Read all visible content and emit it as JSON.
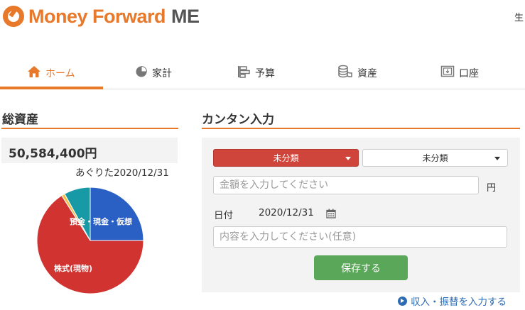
{
  "header": {
    "logo_text": "Money Forward",
    "logo_suffix": "ME",
    "user_link": "生",
    "brand_color": "#e8782a"
  },
  "nav": {
    "items": [
      {
        "label": "ホーム",
        "icon": "home-icon",
        "active": true
      },
      {
        "label": "家計",
        "icon": "pie-chart-icon",
        "active": false
      },
      {
        "label": "予算",
        "icon": "budget-icon",
        "active": false
      },
      {
        "label": "資産",
        "icon": "coins-icon",
        "active": false
      },
      {
        "label": "口座",
        "icon": "account-icon",
        "active": false
      }
    ]
  },
  "assets": {
    "title": "総資産",
    "value": "50,584,400円",
    "date_note": "あぐりた2020/12/31"
  },
  "chart_data": {
    "type": "pie",
    "slices": [
      {
        "label": "預金・現金・仮想",
        "share": 0.25,
        "color": "#2a5fc4"
      },
      {
        "label": "株式(現物)",
        "share": 0.66,
        "color": "#d03330"
      },
      {
        "label": "",
        "share": 0.01,
        "color": "#f2c14e"
      },
      {
        "label": "",
        "share": 0.08,
        "color": "#179aa5"
      }
    ]
  },
  "quick_entry": {
    "title": "カンタン入力",
    "category_main": "未分類",
    "category_sub": "未分類",
    "amount_placeholder": "金額を入力してください",
    "currency_unit": "円",
    "date_label": "日付",
    "date_value": "2020/12/31",
    "memo_placeholder": "内容を入力してください(任意)",
    "save_label": "保存する",
    "transfer_link": "収入・振替を入力する"
  }
}
